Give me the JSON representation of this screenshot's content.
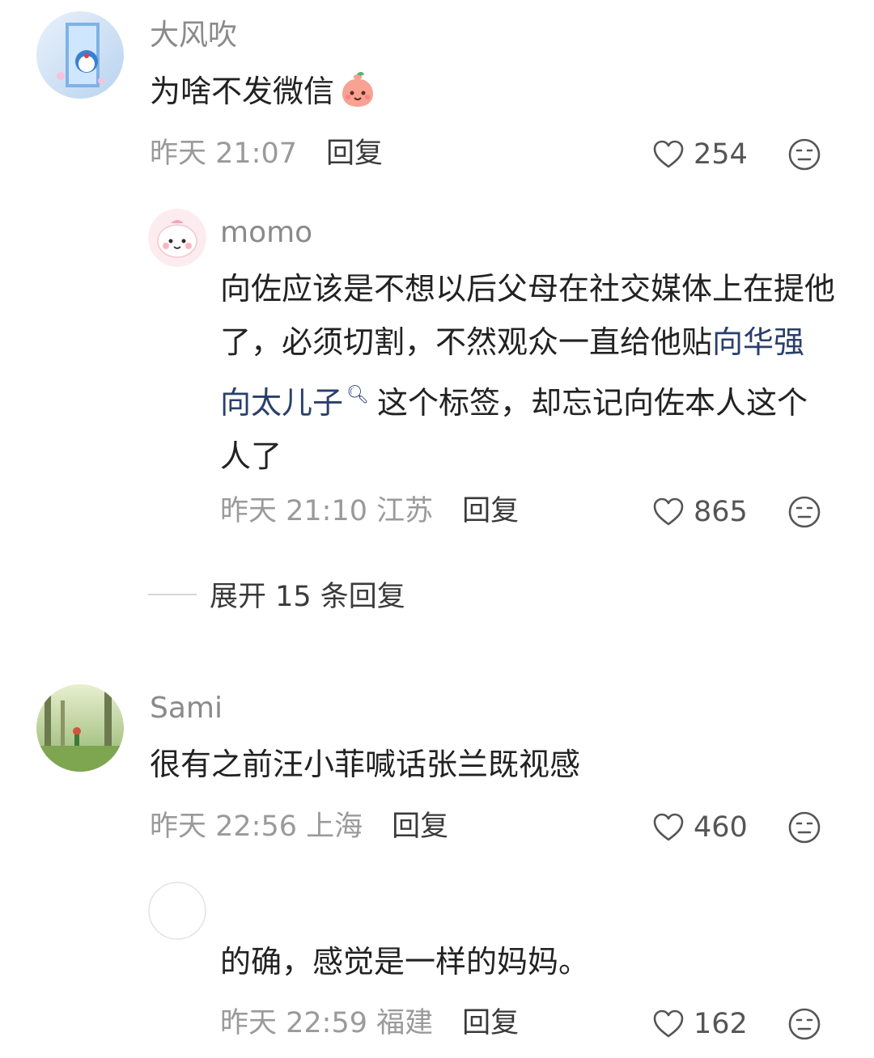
{
  "comments": [
    {
      "user": "大风吹",
      "text": "为啥不发微信",
      "time": "昨天 21:07",
      "reply_label": "回复",
      "likes": "254",
      "replies": [
        {
          "user": "momo",
          "text_before": "向佐应该是不想以后父母在社交媒体上在提他了，必须切割，不然观众一直给他贴",
          "link_text": "向华强向太儿子",
          "text_after": "这个标签，却忘记向佐本人这个人了",
          "time": "昨天 21:10 江苏",
          "reply_label": "回复",
          "likes": "865"
        }
      ],
      "expand_label": "展开 15 条回复"
    },
    {
      "user": "Sami",
      "text": "很有之前汪小菲喊话张兰既视感",
      "time": "昨天 22:56 上海",
      "reply_label": "回复",
      "likes": "460",
      "replies": [
        {
          "user": "",
          "text": "的确，感觉是一样的妈妈。",
          "time": "昨天 22:59 福建",
          "reply_label": "回复",
          "likes": "162"
        }
      ]
    }
  ],
  "icons": {
    "like": "heart-outline-icon",
    "more": "neutral-face-icon",
    "search": "search-icon"
  }
}
